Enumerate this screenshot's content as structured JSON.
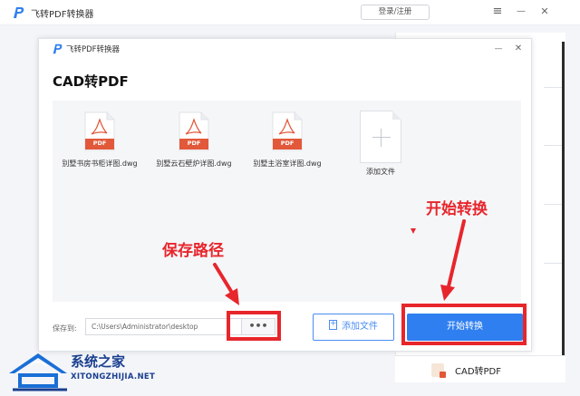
{
  "outer_window": {
    "title": "飞转PDF转换器",
    "login_label": "登录/注册",
    "controls": {
      "menu": "≡",
      "minimize": "—",
      "close": "✕"
    },
    "cad_tab_label": "CAD转PDF"
  },
  "dialog": {
    "title": "飞转PDF转换器",
    "controls": {
      "minimize": "—",
      "close": "✕"
    },
    "page_title": "CAD转PDF",
    "files": [
      {
        "name": "别墅书房书柜详图.dwg",
        "badge": "PDF"
      },
      {
        "name": "别墅云石壁炉详图.dwg",
        "badge": "PDF"
      },
      {
        "name": "别墅主浴室详图.dwg",
        "badge": "PDF"
      }
    ],
    "add_tile_label": "添加文件",
    "save_label": "保存到:",
    "save_path": "C:\\Users\\Administrator\\desktop",
    "browse_label": "•••",
    "add_file_button": "添加文件",
    "start_button": "开始转换"
  },
  "annotations": {
    "save_path_label": "保存路径",
    "start_label": "开始转换",
    "color": "#e7262c"
  },
  "watermark": {
    "cn": "系统之家",
    "en": "XITONGZHIJIA.NET"
  },
  "colors": {
    "accent": "#2f7ff0",
    "pdf_badge": "#e2583a",
    "annotation": "#e7262c"
  },
  "icons": {
    "logo": "p-logo-icon",
    "file": "pdf-file-icon",
    "add": "plus-icon"
  }
}
